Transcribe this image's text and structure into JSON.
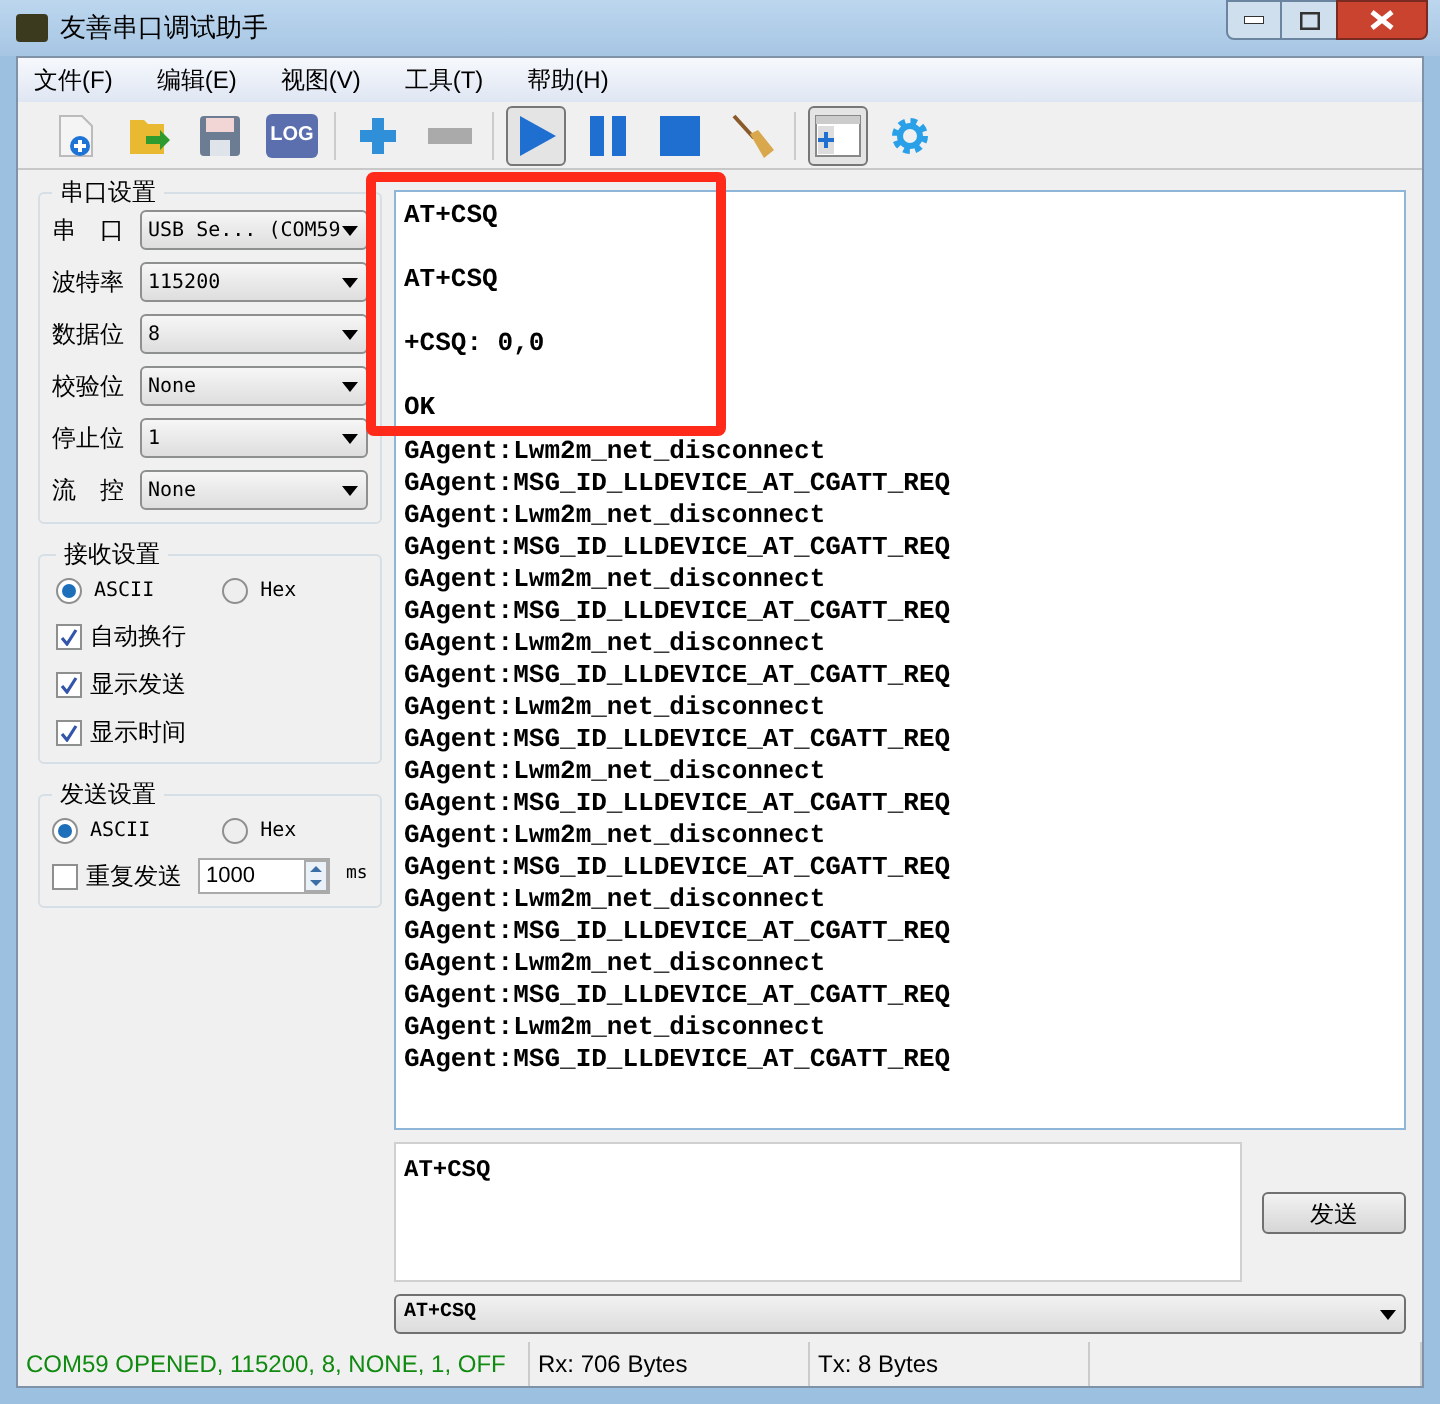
{
  "window": {
    "title": "友善串口调试助手"
  },
  "menu": [
    {
      "label": "文件(F)"
    },
    {
      "label": "编辑(E)"
    },
    {
      "label": "视图(V)"
    },
    {
      "label": "工具(T)"
    },
    {
      "label": "帮助(H)"
    }
  ],
  "toolbar": [
    {
      "kind": "new",
      "pressed": false
    },
    {
      "kind": "open",
      "pressed": false
    },
    {
      "kind": "save",
      "pressed": false
    },
    {
      "kind": "log",
      "label": "LOG",
      "pressed": false
    },
    {
      "kind": "sep"
    },
    {
      "kind": "plus",
      "pressed": false
    },
    {
      "kind": "minus",
      "pressed": false
    },
    {
      "kind": "sep"
    },
    {
      "kind": "play",
      "pressed": true
    },
    {
      "kind": "pause",
      "pressed": false
    },
    {
      "kind": "stop",
      "pressed": false
    },
    {
      "kind": "broom",
      "pressed": false
    },
    {
      "kind": "sep"
    },
    {
      "kind": "panel",
      "pressed": true
    },
    {
      "kind": "gear",
      "pressed": false
    }
  ],
  "serial_settings": {
    "title": "串口设置",
    "fields": [
      {
        "label": "串　口",
        "value": "USB Se... (COM59"
      },
      {
        "label": "波特率",
        "value": "115200"
      },
      {
        "label": "数据位",
        "value": "8"
      },
      {
        "label": "校验位",
        "value": "None"
      },
      {
        "label": "停止位",
        "value": "1"
      },
      {
        "label": "流　控",
        "value": "None"
      }
    ]
  },
  "receive_settings": {
    "title": "接收设置",
    "modes": [
      {
        "label": "ASCII",
        "selected": true
      },
      {
        "label": "Hex",
        "selected": false
      }
    ],
    "options": [
      {
        "label": "自动换行",
        "checked": true
      },
      {
        "label": "显示发送",
        "checked": true
      },
      {
        "label": "显示时间",
        "checked": true
      }
    ]
  },
  "send_settings": {
    "title": "发送设置",
    "modes": [
      {
        "label": "ASCII",
        "selected": true
      },
      {
        "label": "Hex",
        "selected": false
      }
    ],
    "repeat": {
      "label": "重复发送",
      "checked": false,
      "interval": "1000",
      "unit": "ms"
    }
  },
  "log": {
    "commands": [
      "AT+CSQ",
      "AT+CSQ",
      "+CSQ: 0,0",
      "OK"
    ],
    "lines": [
      "GAgent:Lwm2m_net_disconnect",
      "GAgent:MSG_ID_LLDEVICE_AT_CGATT_REQ",
      "GAgent:Lwm2m_net_disconnect",
      "GAgent:MSG_ID_LLDEVICE_AT_CGATT_REQ",
      "GAgent:Lwm2m_net_disconnect",
      "GAgent:MSG_ID_LLDEVICE_AT_CGATT_REQ",
      "GAgent:Lwm2m_net_disconnect",
      "GAgent:MSG_ID_LLDEVICE_AT_CGATT_REQ",
      "GAgent:Lwm2m_net_disconnect",
      "GAgent:MSG_ID_LLDEVICE_AT_CGATT_REQ",
      "GAgent:Lwm2m_net_disconnect",
      "GAgent:MSG_ID_LLDEVICE_AT_CGATT_REQ",
      "GAgent:Lwm2m_net_disconnect",
      "GAgent:MSG_ID_LLDEVICE_AT_CGATT_REQ",
      "GAgent:Lwm2m_net_disconnect",
      "GAgent:MSG_ID_LLDEVICE_AT_CGATT_REQ",
      "GAgent:Lwm2m_net_disconnect",
      "GAgent:MSG_ID_LLDEVICE_AT_CGATT_REQ",
      "GAgent:Lwm2m_net_disconnect",
      "GAgent:MSG_ID_LLDEVICE_AT_CGATT_REQ"
    ]
  },
  "send_input": {
    "value": "AT+CSQ"
  },
  "send_button": {
    "label": "发送"
  },
  "history": {
    "value": "AT+CSQ"
  },
  "status_bar": [
    {
      "kind": "connection",
      "text": "COM59 OPENED, 115200, 8, NONE, 1, OFF"
    },
    {
      "kind": "plain",
      "text": "Rx: 706 Bytes"
    },
    {
      "kind": "plain",
      "text": "Tx: 8 Bytes"
    },
    {
      "kind": "empty"
    }
  ]
}
